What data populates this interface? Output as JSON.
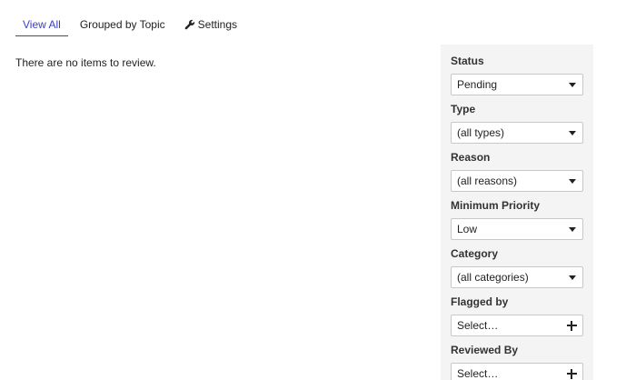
{
  "tabs": [
    {
      "label": "View All",
      "active": true
    },
    {
      "label": "Grouped by Topic",
      "active": false
    },
    {
      "label": "Settings",
      "active": false,
      "icon": "wrench-icon"
    }
  ],
  "main": {
    "empty_message": "There are no items to review."
  },
  "filters": {
    "status": {
      "label": "Status",
      "value": "Pending"
    },
    "type": {
      "label": "Type",
      "value": "(all types)"
    },
    "reason": {
      "label": "Reason",
      "value": "(all reasons)"
    },
    "priority": {
      "label": "Minimum Priority",
      "value": "Low"
    },
    "category": {
      "label": "Category",
      "value": "(all categories)"
    },
    "flagged_by": {
      "label": "Flagged by",
      "value": "Select…"
    },
    "reviewed_by": {
      "label": "Reviewed By",
      "value": "Select…"
    }
  },
  "colors": {
    "accent": "#3b3fc4",
    "sidebar_bg": "#f4f4f4"
  }
}
